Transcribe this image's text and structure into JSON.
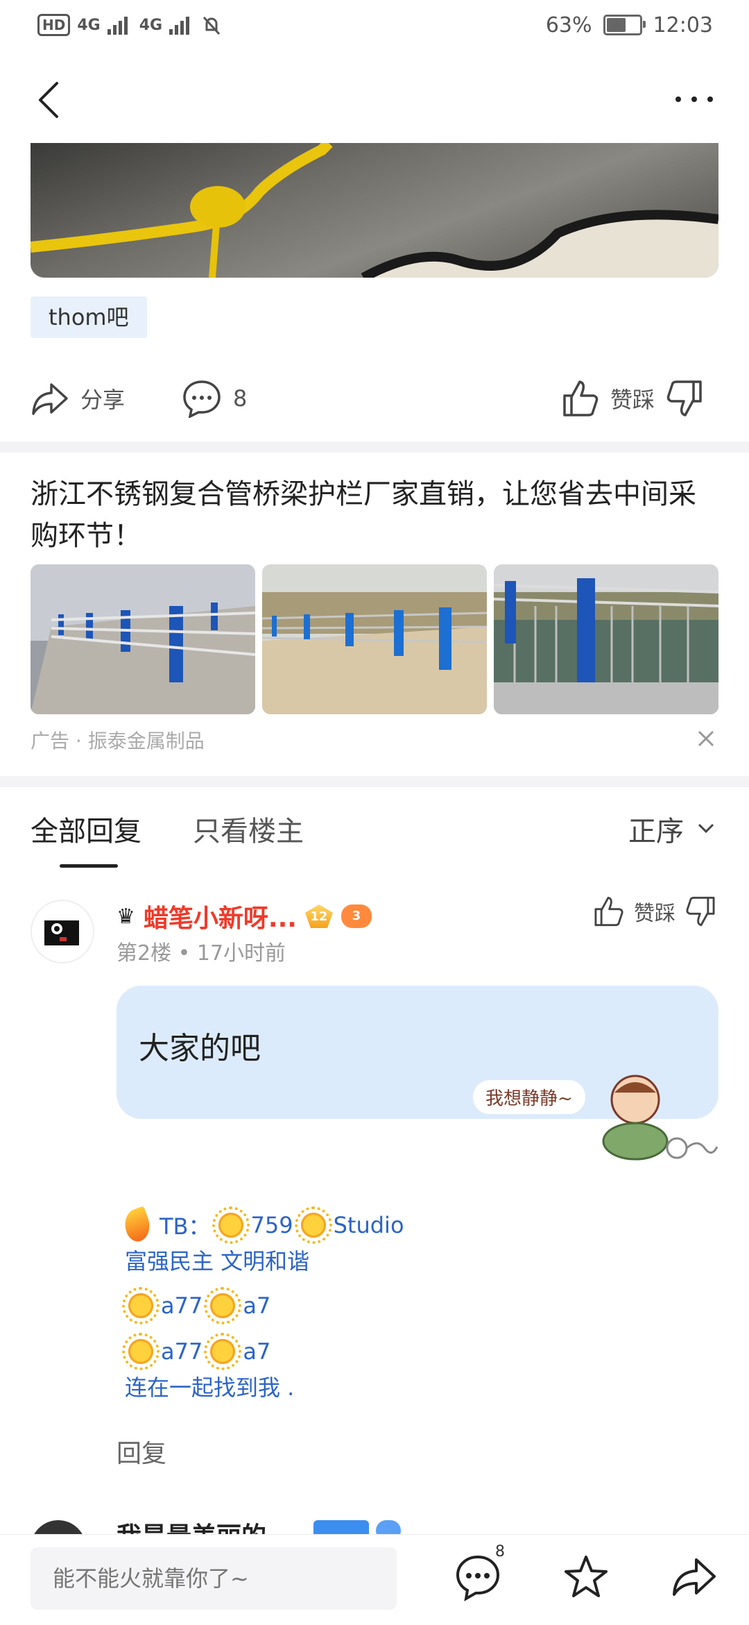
{
  "status_bar": {
    "hd_label": "HD",
    "net1": "4G",
    "net2": "4G",
    "battery_percent": "63%",
    "battery_level": 0.63,
    "time": "12:03"
  },
  "post": {
    "forum_tag": "thom吧",
    "share_label": "分享",
    "comment_count": "8",
    "like_dislike_label": "赞踩"
  },
  "ad": {
    "title": "浙江不锈钢复合管桥梁护栏厂家直销，让您省去中间采购环节！",
    "footer": "广告 · 振泰金属制品"
  },
  "tabs": {
    "all_replies": "全部回复",
    "only_op": "只看楼主",
    "sort_label": "正序"
  },
  "reply": {
    "username": "蜡笔小新呀...",
    "level": "12",
    "game_level": "3",
    "floor": "第2楼",
    "time_ago": "17小时前",
    "like_dislike_label": "赞踩",
    "content": "大家的吧",
    "sticker_text": "我想静静~",
    "signature": {
      "line1_prefix": "TB：",
      "line1_a": "759",
      "line1_b": "Studio",
      "line2": "富强民主 文明和谐",
      "line3_a": "a77",
      "line3_b": "a7",
      "line4_a": "a77",
      "line4_b": "a7",
      "line5": "连在一起找到我 ."
    },
    "reply_label": "回复"
  },
  "next_reply": {
    "username": "我是最美丽的"
  },
  "bottom_bar": {
    "input_placeholder": "能不能火就靠你了~",
    "message_count": "8"
  },
  "colors": {
    "accent_blue": "#2c64c7",
    "username_red": "#f03a2a",
    "bubble_bg": "#dcebfb",
    "tag_bg": "#e8f1fb"
  }
}
